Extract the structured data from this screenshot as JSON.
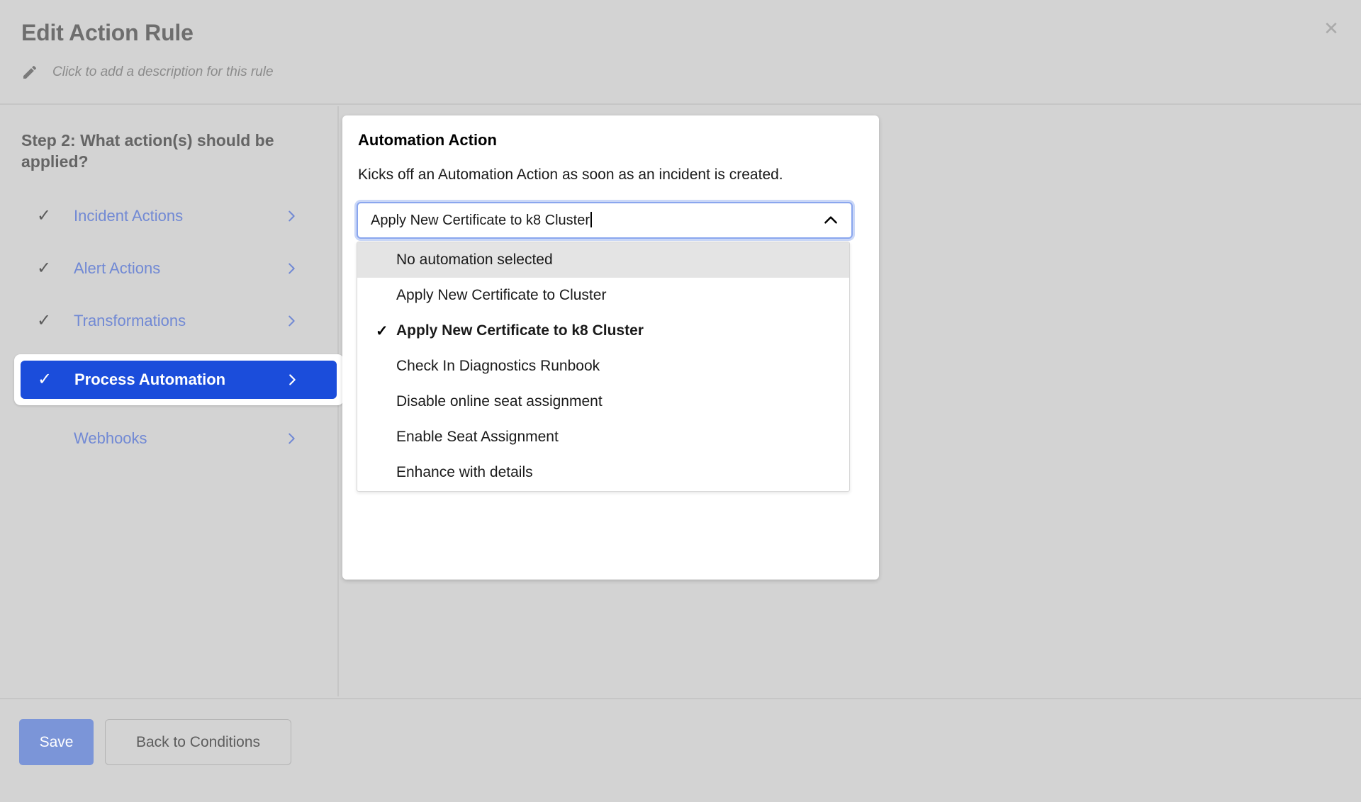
{
  "header": {
    "title": "Edit Action Rule",
    "description_placeholder": "Click to add a description for this rule",
    "close_label": "✕"
  },
  "left_panel": {
    "step_title": "Step 2: What action(s) should be applied?",
    "items": [
      {
        "label": "Incident Actions",
        "check": "✓",
        "chevron": "chevron-right",
        "active": false
      },
      {
        "label": "Alert Actions",
        "check": "✓",
        "chevron": "chevron-right",
        "active": false
      },
      {
        "label": "Transformations",
        "check": "✓",
        "chevron": "chevron-right",
        "active": false
      },
      {
        "label": "Process Automation",
        "check": "✓",
        "chevron": "chevron-right",
        "active": true
      },
      {
        "label": "Webhooks",
        "check": "",
        "chevron": "chevron-right",
        "active": false
      }
    ]
  },
  "card": {
    "title": "Automation Action",
    "description": "Kicks off an Automation Action as soon as an incident is created.",
    "select": {
      "value": "Apply New Certificate to k8 Cluster",
      "expanded": true,
      "arrow": "chevron-up",
      "options": [
        {
          "label": "No automation selected",
          "selected": false,
          "highlighted": true,
          "check": ""
        },
        {
          "label": "Apply New Certificate to Cluster",
          "selected": false,
          "highlighted": false,
          "check": ""
        },
        {
          "label": "Apply New Certificate to k8 Cluster",
          "selected": true,
          "highlighted": false,
          "check": "✓"
        },
        {
          "label": "Check In Diagnostics Runbook",
          "selected": false,
          "highlighted": false,
          "check": ""
        },
        {
          "label": "Disable online seat assignment",
          "selected": false,
          "highlighted": false,
          "check": ""
        },
        {
          "label": "Enable Seat Assignment",
          "selected": false,
          "highlighted": false,
          "check": ""
        },
        {
          "label": "Enhance with details",
          "selected": false,
          "highlighted": false,
          "check": ""
        }
      ]
    }
  },
  "footer": {
    "save_label": "Save",
    "back_label": "Back to Conditions"
  },
  "colors": {
    "page_background": "#d3d3d3",
    "accent_blue": "#1b4ddb",
    "link_blue": "#7189d4",
    "save_blue": "#7b95d8",
    "focus_ring": "#8aa6ee",
    "option_highlight": "#e4e4e4"
  }
}
